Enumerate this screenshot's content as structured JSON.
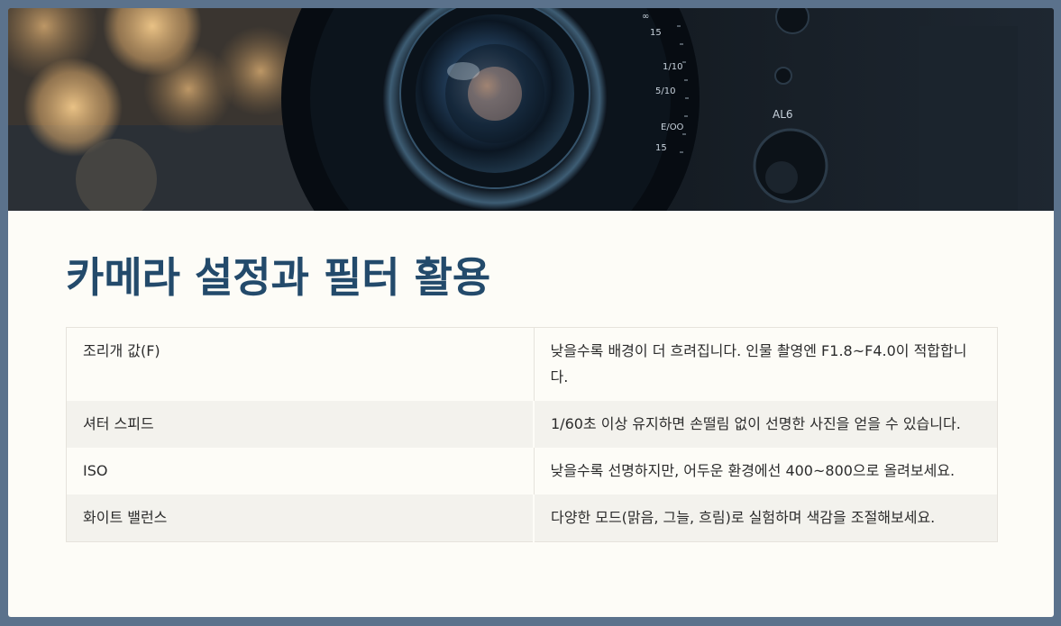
{
  "hero": {
    "lens_markings": [
      "∞",
      "15",
      "1/10",
      "5/10",
      "E/OO",
      "15"
    ],
    "body_marking": "AL6"
  },
  "title": "카메라 설정과 필터 활용",
  "settings": [
    {
      "label": "조리개 값(F)",
      "desc": "낮을수록 배경이 더 흐려집니다. 인물 촬영엔 F1.8~F4.0이 적합합니다."
    },
    {
      "label": "셔터 스피드",
      "desc": "1/60초 이상 유지하면 손떨림 없이 선명한 사진을 얻을 수 있습니다."
    },
    {
      "label": "ISO",
      "desc": "낮을수록 선명하지만, 어두운 환경에선 400~800으로 올려보세요."
    },
    {
      "label": "화이트 밸런스",
      "desc": "다양한 모드(맑음, 그늘, 흐림)로 실험하며 색감을 조절해보세요."
    }
  ]
}
